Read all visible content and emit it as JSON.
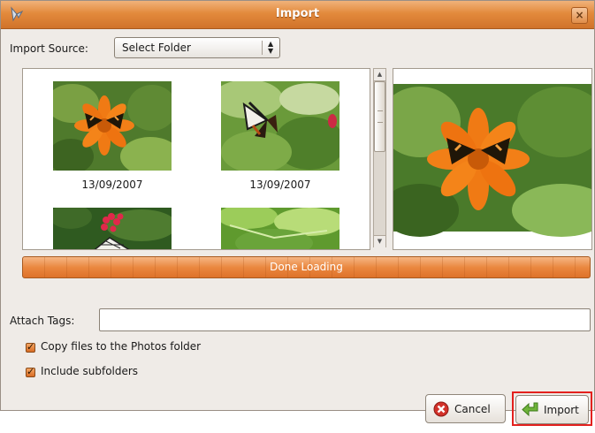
{
  "window": {
    "title": "Import"
  },
  "import_source": {
    "label": "Import Source:",
    "selected": "Select Folder"
  },
  "thumbnails": [
    {
      "date": "13/09/2007",
      "subject": "orange flower with butterfly"
    },
    {
      "date": "13/09/2007",
      "subject": "butterfly on leaves"
    },
    {
      "date": "",
      "subject": "red flowers with butterfly"
    },
    {
      "date": "",
      "subject": "green leaves"
    }
  ],
  "progress": {
    "text": "Done Loading",
    "value": 1.0
  },
  "tags": {
    "label": "Attach Tags:",
    "value": ""
  },
  "options": {
    "copy_files": {
      "label": "Copy files to the Photos folder",
      "checked": true
    },
    "include_subfolders": {
      "label": "Include subfolders",
      "checked": true
    }
  },
  "buttons": {
    "cancel_label": "Cancel",
    "import_label": "Import"
  },
  "colors": {
    "accent": "#e38a3c",
    "highlight": "#e3211e"
  }
}
